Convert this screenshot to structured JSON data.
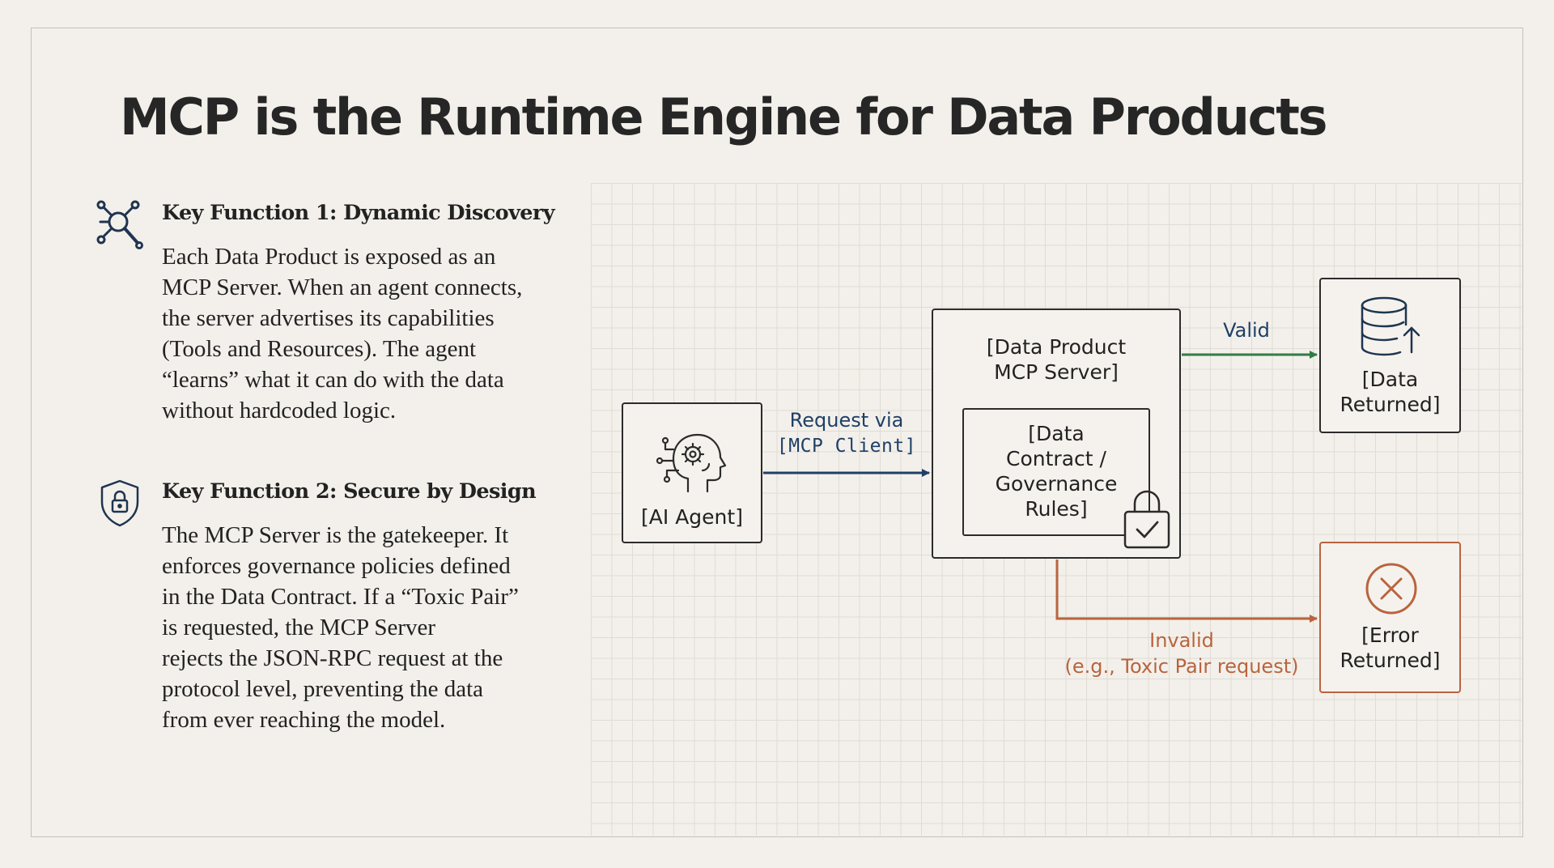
{
  "title": "MCP is the Runtime Engine for Data Products",
  "key_functions": [
    {
      "heading": "Key Function 1: Dynamic Discovery",
      "icon": "network-search-icon",
      "body_lines": [
        "Each Data Product is exposed as an",
        "MCP Server. When an agent connects,",
        "the server advertises its capabilities",
        "(Tools and Resources). The agent",
        "“learns” what it can do with the data",
        "without hardcoded logic."
      ]
    },
    {
      "heading": "Key Function 2: Secure by Design",
      "icon": "shield-lock-icon",
      "body_lines": [
        "The MCP Server is the gatekeeper. It",
        "enforces governance policies defined",
        "in the Data Contract. If a “Toxic Pair”",
        "is requested, the MCP Server",
        "rejects the JSON-RPC request at the",
        "protocol level, preventing the data",
        "from ever reaching the model."
      ]
    }
  ],
  "diagram": {
    "agent": {
      "label": "[AI Agent]",
      "icon": "ai-head-gear-icon"
    },
    "request_label": {
      "line1": "Request via",
      "line2": "[MCP Client]"
    },
    "server": {
      "line1": "[Data Product",
      "line2": "MCP Server]"
    },
    "contract": {
      "line1": "[Data",
      "line2": "Contract /",
      "line3": "Governance",
      "line4": "Rules]",
      "icon": "padlock-check-icon"
    },
    "valid_label": "Valid",
    "data_returned": {
      "line1": "[Data",
      "line2": "Returned]",
      "icon": "database-upload-icon"
    },
    "invalid_label": {
      "line1": "Invalid",
      "line2": "(e.g., Toxic Pair request)"
    },
    "error_returned": {
      "line1": "[Error",
      "line2": "Returned]",
      "icon": "error-x-circle-icon"
    },
    "colors": {
      "request": "#1f3f66",
      "valid": "#2f7d45",
      "invalid": "#b9643e",
      "box_border": "#2b2b2b"
    }
  }
}
